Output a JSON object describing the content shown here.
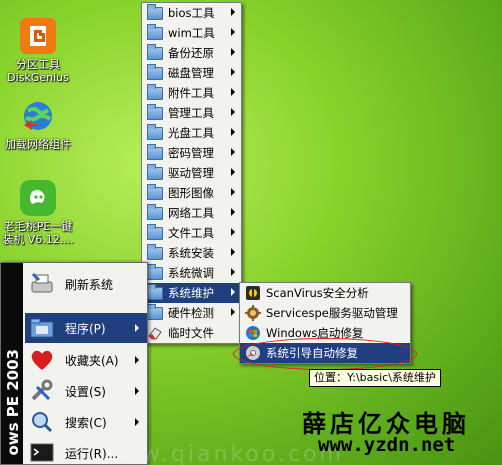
{
  "desktop_icons": [
    {
      "label": "分区工具\nDiskGenius",
      "icon": "diskgenius-icon"
    },
    {
      "label": "加载网络组件",
      "icon": "network-globe-icon"
    },
    {
      "label": "老毛桃PE一键\n装机 V6.12....",
      "icon": "pe-installer-icon"
    }
  ],
  "start_menu": {
    "band_text": "ows PE 2003",
    "items": [
      {
        "label": "刷新系统",
        "icon": "refresh-printer-icon",
        "arrow": false
      },
      {
        "label": "程序(P)",
        "icon": "programs-folder-icon",
        "arrow": true
      },
      {
        "label": "收藏夹(A)",
        "icon": "heart-icon",
        "arrow": true
      },
      {
        "label": "设置(S)",
        "icon": "tools-icon",
        "arrow": true
      },
      {
        "label": "搜索(C)",
        "icon": "search-icon",
        "arrow": true
      },
      {
        "label": "运行(R)...",
        "icon": "run-icon",
        "arrow": false
      }
    ]
  },
  "programs_menu": [
    {
      "label": "bios工具",
      "arrow": true
    },
    {
      "label": "wim工具",
      "arrow": true
    },
    {
      "label": "备份还原",
      "arrow": true
    },
    {
      "label": "磁盘管理",
      "arrow": true
    },
    {
      "label": "附件工具",
      "arrow": true
    },
    {
      "label": "管理工具",
      "arrow": true
    },
    {
      "label": "光盘工具",
      "arrow": true
    },
    {
      "label": "密码管理",
      "arrow": true
    },
    {
      "label": "驱动管理",
      "arrow": true
    },
    {
      "label": "图形图像",
      "arrow": true
    },
    {
      "label": "网络工具",
      "arrow": true
    },
    {
      "label": "文件工具",
      "arrow": true
    },
    {
      "label": "系统安装",
      "arrow": true
    },
    {
      "label": "系统微调",
      "arrow": true
    },
    {
      "label": "系统维护",
      "arrow": true,
      "selected": true
    },
    {
      "label": "硬件检测",
      "arrow": true
    },
    {
      "label": "临时文件",
      "arrow": false
    }
  ],
  "maintenance_menu": [
    {
      "label": "ScanVirus安全分析",
      "icon": "scanvirus-icon"
    },
    {
      "label": "Servicespe服务驱动管理",
      "icon": "service-gear-icon"
    },
    {
      "label": "Windows启动修复",
      "icon": "windows-repair-icon"
    },
    {
      "label": "系统引导自动修复",
      "icon": "boot-repair-icon",
      "selected": true
    }
  ],
  "tooltip": "位置：Y:\\basic\\系统维护",
  "watermark": {
    "title": "薛店亿众电脑",
    "url": "www.yzdn.net",
    "faint": "www.qiankoo.com"
  },
  "colors": {
    "selection": "#1f3f7e",
    "menu_bg": "#f2f2ee",
    "highlight_oval": "#d8202a"
  }
}
